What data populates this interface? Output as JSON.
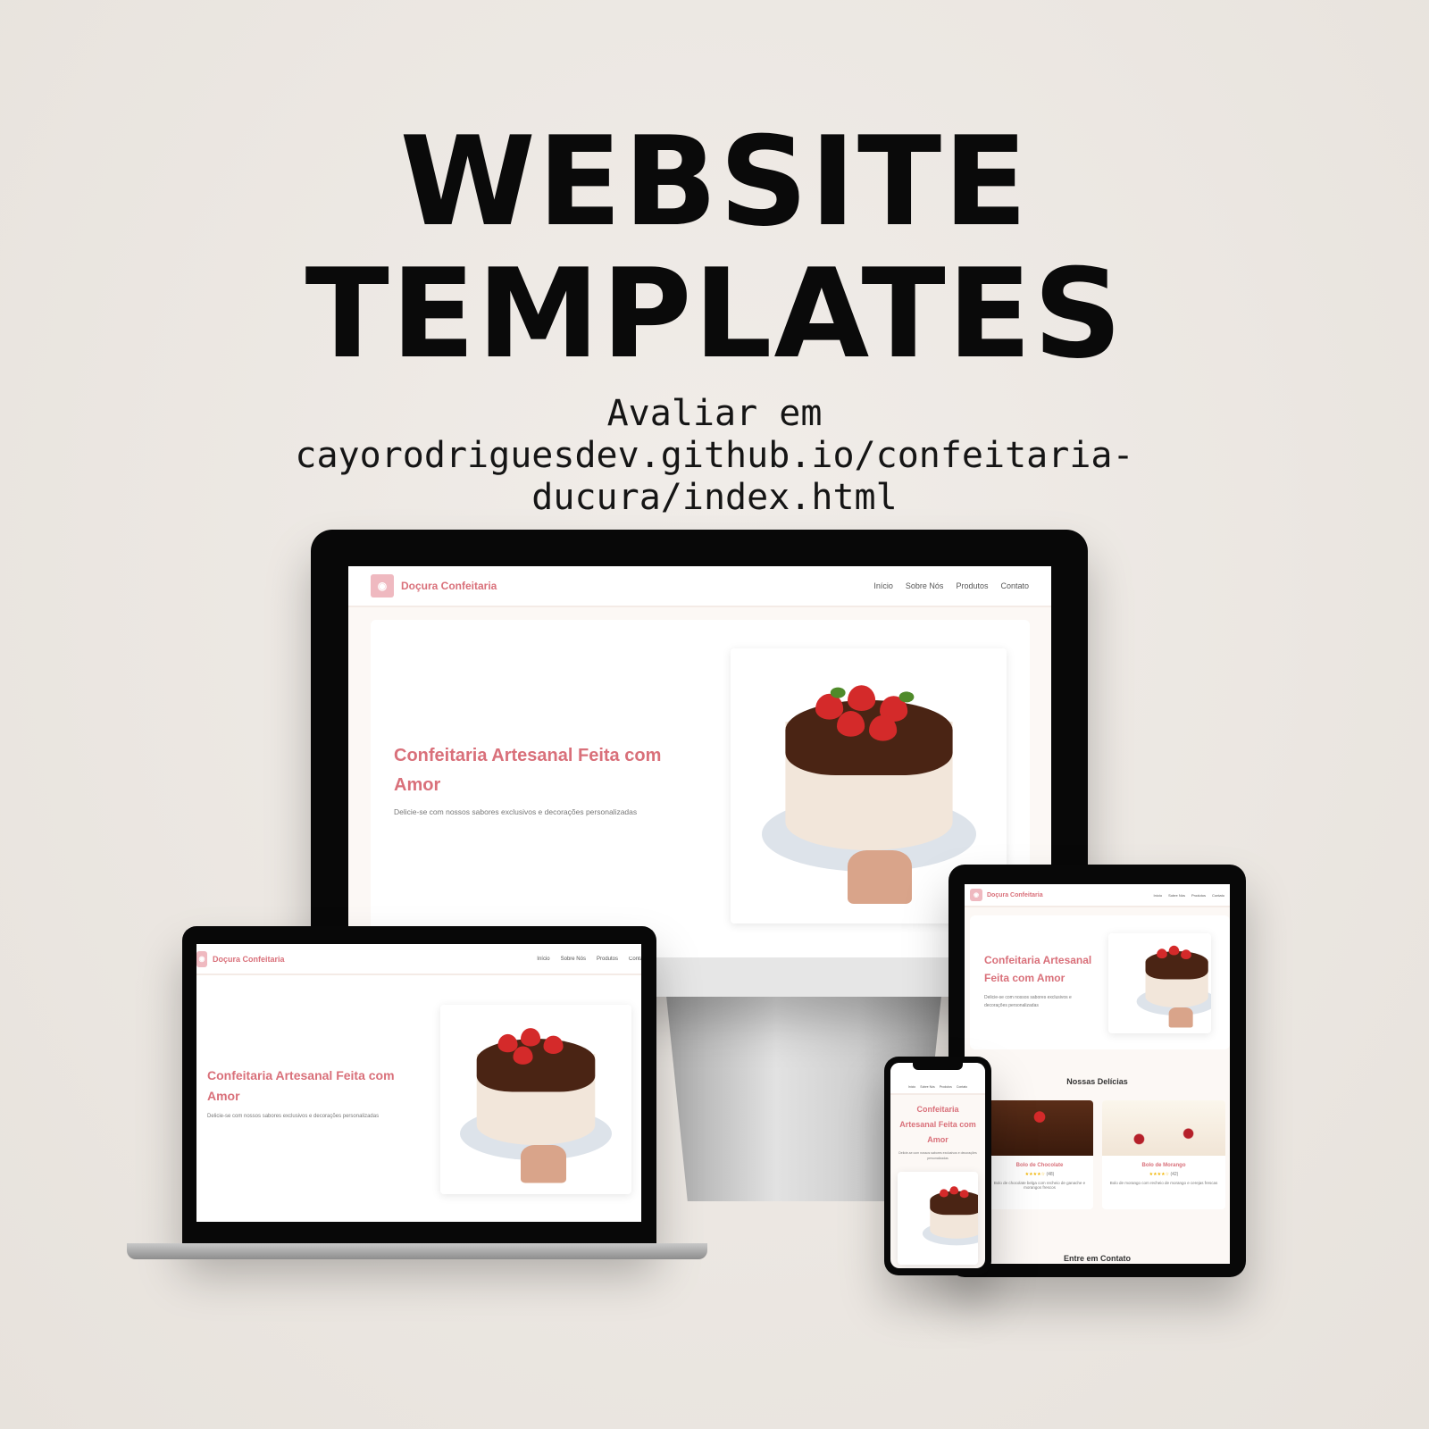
{
  "promo": {
    "title_line1": "WEBSITE",
    "title_line2": "TEMPLATES",
    "subtitle_line1": "Avaliar em",
    "subtitle_line2": "cayorodriguesdev.github.io/confeitaria-",
    "subtitle_line3": "ducura/index.html"
  },
  "site": {
    "brand": "Doçura Confeitaria",
    "logo_icon": "cupcake-icon",
    "nav": [
      "Início",
      "Sobre Nós",
      "Produtos",
      "Contato"
    ],
    "hero": {
      "title": "Confeitaria Artesanal Feita com Amor",
      "text": "Delicie-se com nossos sabores exclusivos e decorações personalizadas"
    },
    "products_title": "Nossas Delícias",
    "products": [
      {
        "name": "Bolo de Chocolate",
        "stars": "★★★★☆",
        "rating_count": "(48)",
        "desc": "Bolo de chocolate belga com recheio de ganache e morangos frescos"
      },
      {
        "name": "Bolo de Morango",
        "stars": "★★★★☆",
        "rating_count": "(42)",
        "desc": "Bolo de morango com recheio de morango e cerejas frescas"
      }
    ],
    "contact_title": "Entre em Contato"
  },
  "colors": {
    "accent": "#d9707a",
    "background": "#ebe6e1",
    "page_bg": "#fcf8f5"
  }
}
